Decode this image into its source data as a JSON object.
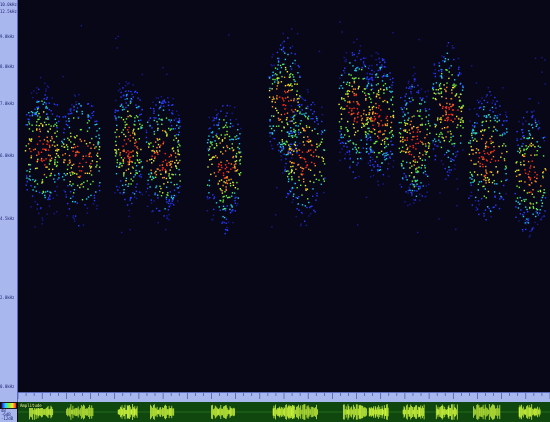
{
  "frequency_axis": {
    "labels": [
      {
        "text": "10.0kHz",
        "f": 10.0
      },
      {
        "text": "12.5kHz",
        "f": 12.5
      },
      {
        "text": "9.0kHz",
        "f": 9.0
      },
      {
        "text": "8.0kHz",
        "f": 8.0
      },
      {
        "text": "7.0kHz",
        "f": 7.0
      },
      {
        "text": "6.0kHz",
        "f": 6.0
      },
      {
        "text": "4.5kHz",
        "f": 4.5
      },
      {
        "text": "2.0kHz",
        "f": 2.0
      },
      {
        "text": "0.0kHz",
        "f": 0.0
      }
    ]
  },
  "waveform": {
    "title": "Amplitude",
    "left_labels": [
      "dB",
      "-6dB",
      "-12dB"
    ]
  },
  "colors": {
    "background": "#0a0a14",
    "panel": "#a9b7ef",
    "waveform_bg": "#10470f",
    "waveform_line": "#c9f23a"
  },
  "calls": [
    {
      "center": 0.052,
      "width": 0.022,
      "peak": 0.38
    },
    {
      "center": 0.137,
      "width": 0.025,
      "peak": 0.4
    },
    {
      "center": 0.242,
      "width": 0.018,
      "peak": 0.37
    },
    {
      "center": 0.318,
      "width": 0.022,
      "peak": 0.4
    },
    {
      "center": 0.452,
      "width": 0.022,
      "peak": 0.42
    },
    {
      "center": 0.585,
      "width": 0.02,
      "peak": 0.26
    },
    {
      "center": 0.631,
      "width": 0.025,
      "peak": 0.4
    },
    {
      "center": 0.742,
      "width": 0.022,
      "peak": 0.28
    },
    {
      "center": 0.794,
      "width": 0.018,
      "peak": 0.3
    },
    {
      "center": 0.871,
      "width": 0.02,
      "peak": 0.36
    },
    {
      "center": 0.944,
      "width": 0.02,
      "peak": 0.28
    },
    {
      "center": 1.032,
      "width": 0.025,
      "peak": 0.4
    },
    {
      "center": 1.126,
      "width": 0.02,
      "peak": 0.44
    }
  ],
  "tail_extent": 1.0
}
